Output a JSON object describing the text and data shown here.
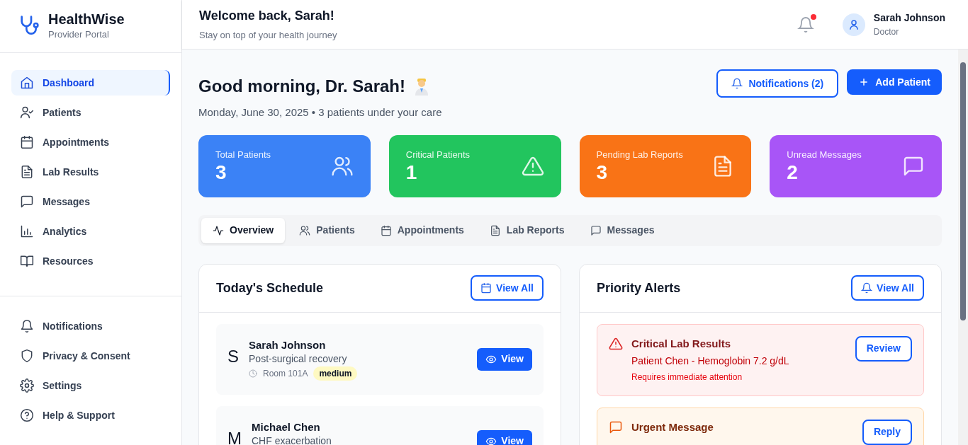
{
  "brand": {
    "name": "HealthWise",
    "subtitle": "Provider Portal"
  },
  "nav": [
    {
      "label": "Dashboard",
      "selected": true
    },
    {
      "label": "Patients",
      "selected": false
    },
    {
      "label": "Appointments",
      "selected": false
    },
    {
      "label": "Lab Results",
      "selected": false
    },
    {
      "label": "Messages",
      "selected": false
    },
    {
      "label": "Analytics",
      "selected": false
    },
    {
      "label": "Resources",
      "selected": false
    }
  ],
  "nav_bottom": [
    {
      "label": "Notifications"
    },
    {
      "label": "Privacy & Consent"
    },
    {
      "label": "Settings"
    },
    {
      "label": "Help & Support"
    }
  ],
  "header": {
    "title": "Welcome back, Sarah!",
    "subtitle": "Stay on top of your health journey",
    "has_unread": true,
    "user_name": "Sarah Johnson",
    "user_role": "Doctor"
  },
  "greeting": {
    "title": "Good morning, Dr. Sarah!",
    "subtitle": "Monday, June 30, 2025 • 3 patients under your care"
  },
  "actions": [
    "Notifications (2)",
    "Add Patient"
  ],
  "stats": [
    {
      "label": "Total Patients",
      "value": "3",
      "color": "#3b82f6"
    },
    {
      "label": "Critical Patients",
      "value": "1",
      "color": "#22c55e"
    },
    {
      "label": "Pending Lab Reports",
      "value": "3",
      "color": "#f97316"
    },
    {
      "label": "Unread Messages",
      "value": "2",
      "color": "#a855f7"
    }
  ],
  "tabs": [
    {
      "label": "Overview",
      "selected": true
    },
    {
      "label": "Patients",
      "selected": false
    },
    {
      "label": "Appointments",
      "selected": false
    },
    {
      "label": "Lab Reports",
      "selected": false
    },
    {
      "label": "Messages",
      "selected": false
    }
  ],
  "schedule": {
    "title": "Today's Schedule",
    "button": "View All",
    "items": [
      {
        "initial": "S",
        "name": "Sarah Johnson",
        "reason": "Post-surgical recovery",
        "room": "Room 101A",
        "priority": "medium",
        "action": "View"
      },
      {
        "initial": "M",
        "name": "Michael Chen",
        "reason": "CHF exacerbation",
        "action": "View"
      }
    ]
  },
  "alerts": {
    "title": "Priority Alerts",
    "button": "View All",
    "items": [
      {
        "kind": "critical",
        "title": "Critical Lab Results",
        "detail": "Patient Chen - Hemoglobin 7.2 g/dL",
        "note": "Requires immediate attention",
        "action": "Review"
      },
      {
        "kind": "message",
        "title": "Urgent Message",
        "action": "Reply"
      }
    ]
  }
}
